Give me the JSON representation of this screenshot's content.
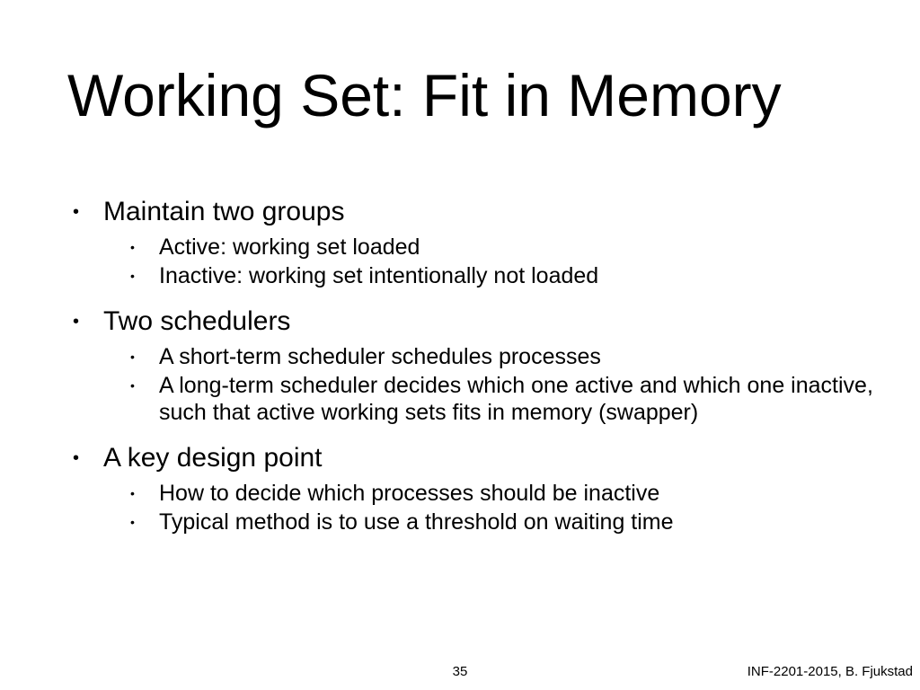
{
  "title": "Working Set: Fit in Memory",
  "bullets": [
    {
      "text": "Maintain two groups",
      "sub": [
        "Active: working set loaded",
        "Inactive: working set intentionally not loaded"
      ]
    },
    {
      "text": "Two schedulers",
      "sub": [
        "A short-term scheduler schedules processes",
        "A long-term scheduler decides which one active and which one inactive, such that active working sets fits in memory (swapper)"
      ]
    },
    {
      "text": "A key design point",
      "sub": [
        "How to decide which processes should be inactive",
        "Typical method is to use a threshold on waiting time"
      ]
    }
  ],
  "footer": {
    "page": "35",
    "right": "INF-2201-2015, B. Fjukstad"
  }
}
